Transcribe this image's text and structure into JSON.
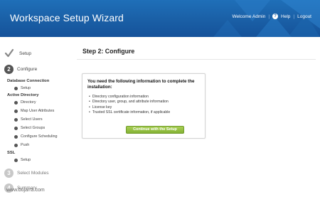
{
  "header": {
    "title": "Workspace Setup Wizard",
    "welcome": "Welcome Admin",
    "help_label": "Help",
    "logout_label": "Logout"
  },
  "sidebar": {
    "steps": [
      {
        "number": "",
        "label": "Setup",
        "state": "complete"
      },
      {
        "number": "2",
        "label": "Configure",
        "state": "active"
      },
      {
        "number": "3",
        "label": "Select Modules",
        "state": "pending"
      },
      {
        "number": "4",
        "label": "Summary",
        "state": "pending"
      }
    ],
    "groups": [
      {
        "title": "Database Connection",
        "items": [
          "Setup"
        ]
      },
      {
        "title": "Active Directory",
        "items": [
          "Directory",
          "Map User Attributes",
          "Select Users",
          "Select Groups",
          "Configure Scheduling",
          "Push"
        ]
      },
      {
        "title": "SSL",
        "items": [
          "Setup"
        ]
      }
    ]
  },
  "main": {
    "title": "Step 2: Configure",
    "info_heading": "You need the following information to complete the installation:",
    "info_items": [
      "Directory configuration information",
      "Directory user, group, and attribute information",
      "License key",
      "Trusted SSL certificate information, if applicable"
    ],
    "continue_label": "Continue with the Setup Wizard »"
  },
  "watermark": "www.bujarra.com",
  "colors": {
    "header": "#1a5fa6",
    "button": "#93bd3e"
  }
}
